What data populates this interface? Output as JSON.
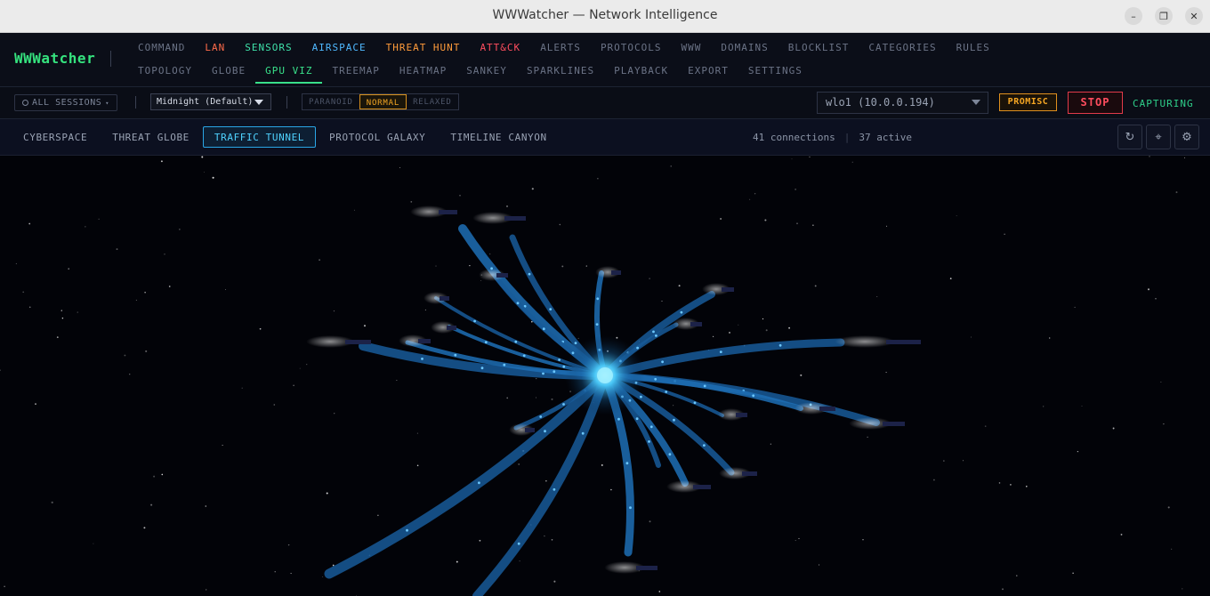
{
  "window": {
    "title": "WWWatcher — Network Intelligence",
    "minimize_icon": "minimize-icon",
    "maximize_icon": "maximize-icon",
    "close_icon": "close-icon"
  },
  "brand": "WWWatcher",
  "nav": {
    "row1": [
      "COMMAND",
      "LAN",
      "SENSORS",
      "AIRSPACE",
      "THREAT HUNT",
      "ATT&CK",
      "ALERTS",
      "PROTOCOLS",
      "WWW",
      "DOMAINS",
      "BLOCKLIST",
      "CATEGORIES",
      "RULES"
    ],
    "row2": [
      "TOPOLOGY",
      "GLOBE",
      "GPU VIZ",
      "TREEMAP",
      "HEATMAP",
      "SANKEY",
      "SPARKLINES",
      "PLAYBACK",
      "EXPORT",
      "SETTINGS"
    ],
    "active": "GPU VIZ"
  },
  "toolbar": {
    "sessions_label": "ALL SESSIONS",
    "theme_value": "Midnight (Default)",
    "modes": [
      "PARANOID",
      "NORMAL",
      "RELAXED"
    ],
    "active_mode": "NORMAL",
    "interface_value": "wlo1 (10.0.0.194)",
    "promisc_label": "PROMISC",
    "stop_label": "STOP",
    "status_label": "CAPTURING"
  },
  "viz": {
    "tabs": [
      "CYBERSPACE",
      "THREAT GLOBE",
      "TRAFFIC TUNNEL",
      "PROTOCOL GALAXY",
      "TIMELINE CANYON"
    ],
    "active_tab": "TRAFFIC TUNNEL",
    "connections_text": "41 connections",
    "active_text": "37 active",
    "buttons": {
      "reset_icon": "refresh-icon",
      "focus_icon": "crosshair-icon",
      "settings_icon": "gear-icon"
    }
  },
  "colors": {
    "accent_green": "#35e27e",
    "tunnel_blue": "#1e6fb8",
    "core_glow": "#4fd2ff",
    "stop_red": "#ff4d5e",
    "promisc_orange": "#f5a623"
  }
}
